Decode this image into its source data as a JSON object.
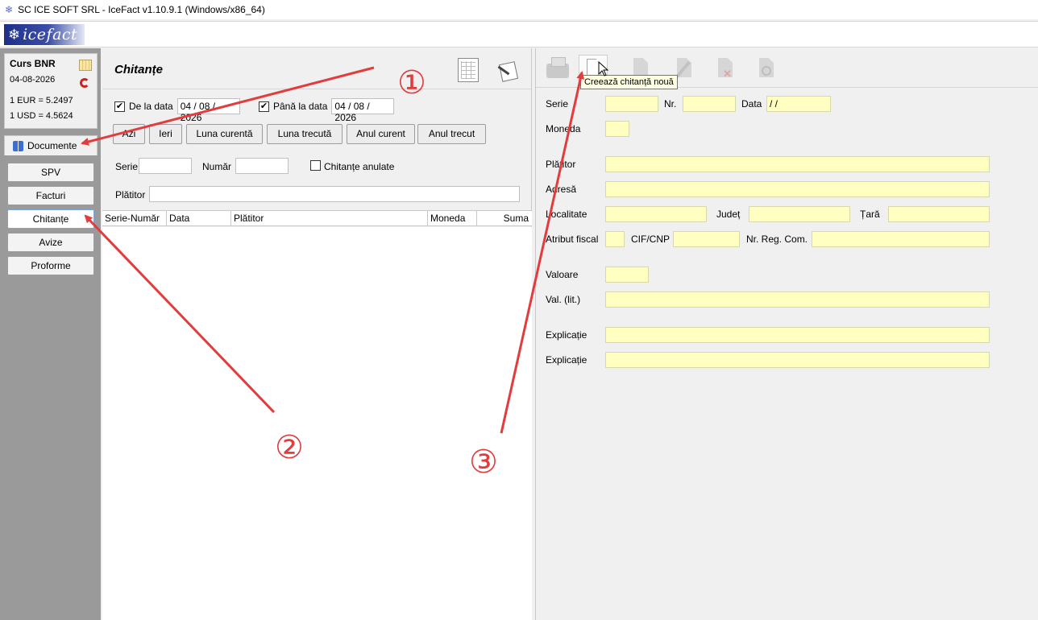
{
  "window": {
    "title": "SC ICE SOFT SRL - IceFact v1.10.9.1 (Windows/x86_64)"
  },
  "brand": {
    "logo_text": "icefact"
  },
  "rates": {
    "title": "Curs BNR",
    "date": "04-08-2026",
    "eur": "1 EUR = 5.2497",
    "usd": "1 USD = 4.5624"
  },
  "sidebar": {
    "tab_label": "Documente",
    "items": [
      {
        "label": "SPV"
      },
      {
        "label": "Facturi"
      },
      {
        "label": "Chitanțe"
      },
      {
        "label": "Avize"
      },
      {
        "label": "Proforme"
      }
    ]
  },
  "list": {
    "title": "Chitanțe",
    "from_label": "De la data",
    "from_value": "04 / 08 / 2026",
    "to_label": "Până la data",
    "to_value": "04 / 08 / 2026",
    "quick_buttons": [
      "Azi",
      "Ieri",
      "Luna curentă",
      "Luna trecută",
      "Anul curent",
      "Anul trecut"
    ],
    "serie_label": "Serie",
    "numar_label": "Număr",
    "anulate_label": "Chitanțe anulate",
    "platitor_label": "Plătitor",
    "columns": [
      "Serie-Număr",
      "Data",
      "Plătitor",
      "Moneda",
      "Suma"
    ]
  },
  "detail": {
    "tooltip": "Creează chitanță nouă",
    "labels": {
      "serie": "Serie",
      "nr": "Nr.",
      "data": "Data",
      "moneda": "Moneda",
      "platitor": "Plătitor",
      "adresa": "Adresă",
      "localitate": "Localitate",
      "judet": "Județ",
      "tara": "Țară",
      "atribut": "Atribut fiscal",
      "cif": "CIF/CNP",
      "regcom": "Nr. Reg. Com.",
      "valoare": "Valoare",
      "vallit": "Val. (lit.)",
      "explicatie1": "Explicație",
      "explicatie2": "Explicație"
    },
    "data_value": "  /    /"
  },
  "annotations": [
    "①",
    "②",
    "③"
  ],
  "colors": {
    "annotation": "#e23c3c",
    "field_yellow": "#ffffc2",
    "logo_blue": "#1e2f87"
  }
}
